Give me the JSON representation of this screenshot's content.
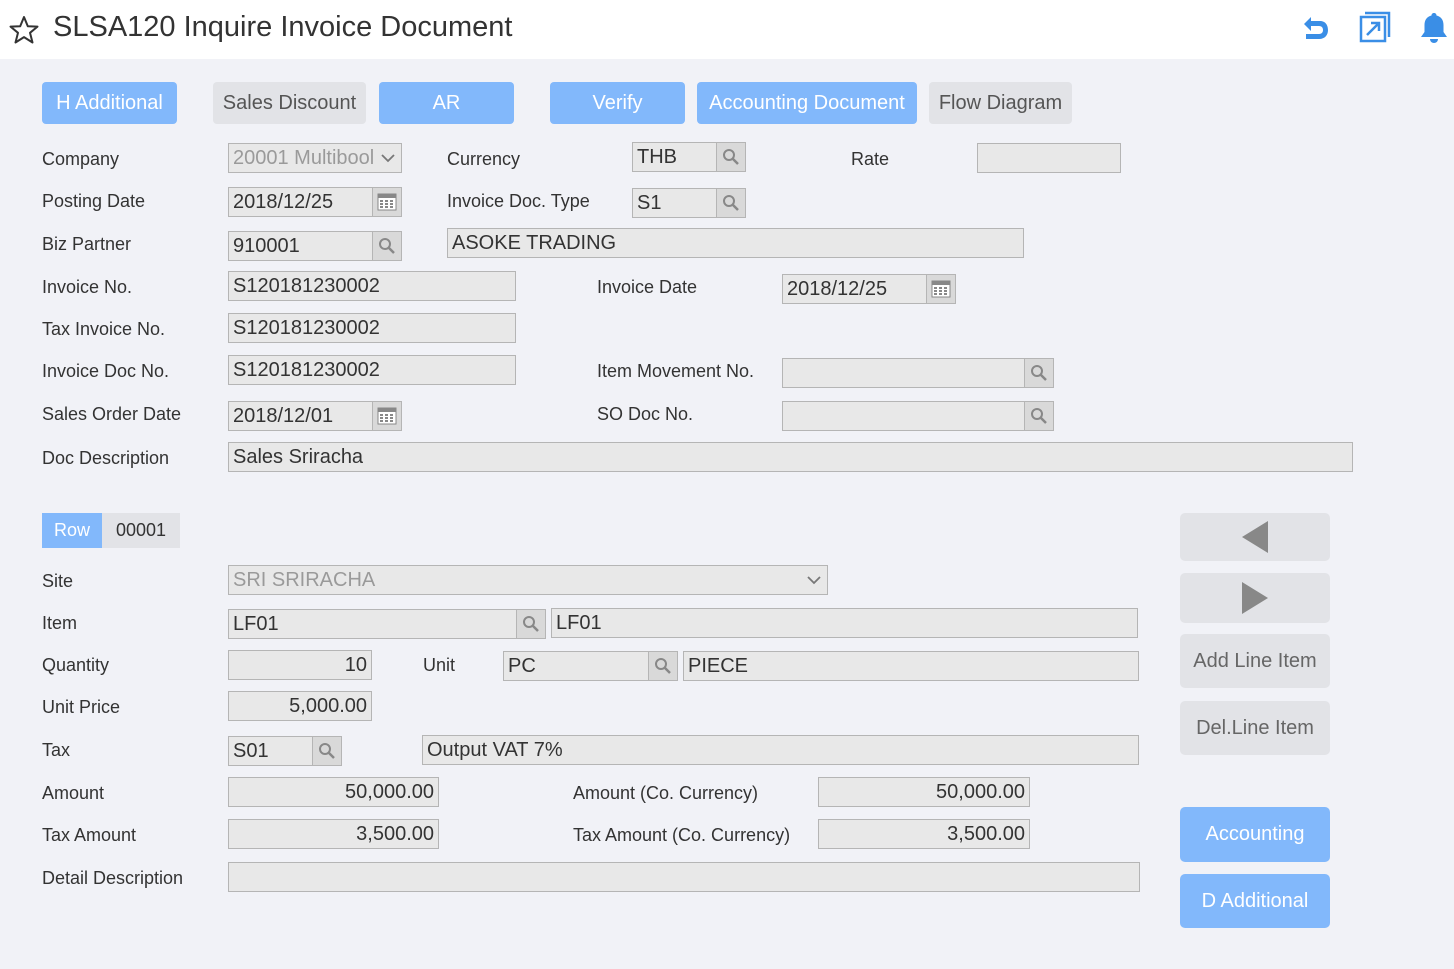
{
  "header": {
    "title": "SLSA120 Inquire Invoice Document",
    "icons": [
      "star-icon",
      "undo-icon",
      "open-window-icon",
      "bell-icon"
    ],
    "accent": "#3a8ee6"
  },
  "top_tabs": {
    "h_additional": "H Additional",
    "sales_discount": "Sales Discount",
    "ar": "AR",
    "verify": "Verify",
    "accounting_document": "Accounting Document",
    "flow_diagram": "Flow Diagram"
  },
  "header_form": {
    "company_label": "Company",
    "company_value": "20001 Multibool",
    "currency_label": "Currency",
    "currency_value": "THB",
    "rate_label": "Rate",
    "rate_value": "",
    "posting_date_label": "Posting Date",
    "posting_date_value": "2018/12/25",
    "invoice_doc_type_label": "Invoice Doc. Type",
    "invoice_doc_type_value": "S1",
    "biz_partner_label": "Biz Partner",
    "biz_partner_value": "910001",
    "biz_partner_name": "ASOKE TRADING",
    "invoice_no_label": "Invoice No.",
    "invoice_no_value": "S120181230002",
    "invoice_date_label": "Invoice Date",
    "invoice_date_value": "2018/12/25",
    "tax_invoice_no_label": "Tax Invoice No.",
    "tax_invoice_no_value": "S120181230002",
    "invoice_doc_no_label": "Invoice Doc No.",
    "invoice_doc_no_value": "S120181230002",
    "item_movement_no_label": "Item Movement No.",
    "item_movement_no_value": "",
    "sales_order_date_label": "Sales Order Date",
    "sales_order_date_value": "2018/12/01",
    "so_doc_no_label": "SO Doc No.",
    "so_doc_no_value": "",
    "doc_description_label": "Doc Description",
    "doc_description_value": "Sales Sriracha"
  },
  "line": {
    "row_label": "Row",
    "row_value": "00001",
    "site_label": "Site",
    "site_value": "SRI SRIRACHA",
    "item_label": "Item",
    "item_code": "LF01",
    "item_name": "LF01",
    "quantity_label": "Quantity",
    "quantity_value": "10",
    "unit_label": "Unit",
    "unit_code": "PC",
    "unit_name": "PIECE",
    "unit_price_label": "Unit Price",
    "unit_price_value": "5,000.00",
    "tax_label": "Tax",
    "tax_code": "S01",
    "tax_name": "Output VAT 7%",
    "amount_label": "Amount",
    "amount_value": "50,000.00",
    "amount_co_label": "Amount (Co. Currency)",
    "amount_co_value": "50,000.00",
    "tax_amount_label": "Tax Amount",
    "tax_amount_value": "3,500.00",
    "tax_amount_co_label": "Tax Amount (Co. Currency)",
    "tax_amount_co_value": "3,500.00",
    "detail_description_label": "Detail Description",
    "detail_description_value": ""
  },
  "side_buttons": {
    "add_line_item": "Add Line Item",
    "del_line_item": "Del.Line Item",
    "accounting": "Accounting",
    "d_additional": "D Additional"
  }
}
